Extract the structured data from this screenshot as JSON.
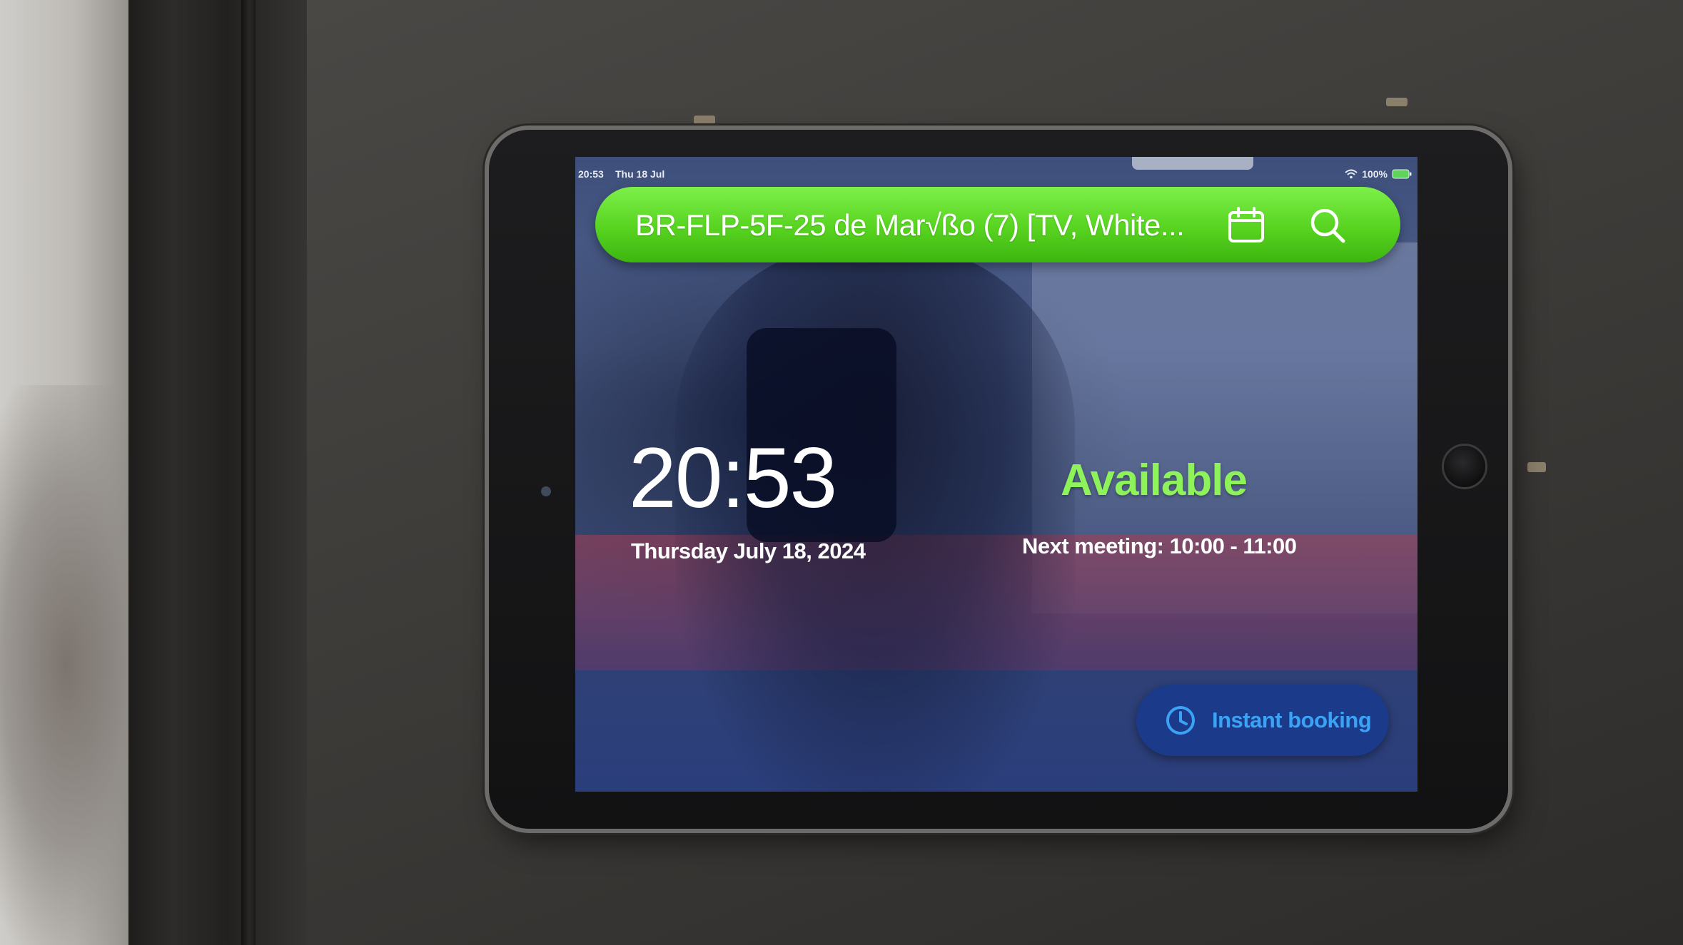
{
  "status_bar": {
    "time": "20:53",
    "date": "Thu 18 Jul",
    "battery": "100%"
  },
  "room_bar": {
    "room_name": "BR-FLP-5F-25 de Mar√ßo (7) [TV, White...",
    "calendar_icon": "calendar-icon",
    "search_icon": "search-icon",
    "color": "#57d320"
  },
  "clock": {
    "time": "20:53",
    "date": "Thursday July 18, 2024"
  },
  "status": {
    "label": "Available",
    "color": "#8ef25a",
    "next_meeting": "Next meeting: 10:00 - 11:00"
  },
  "instant_booking": {
    "label": "Instant booking",
    "icon": "clock-icon",
    "color": "#3ba3f5"
  }
}
